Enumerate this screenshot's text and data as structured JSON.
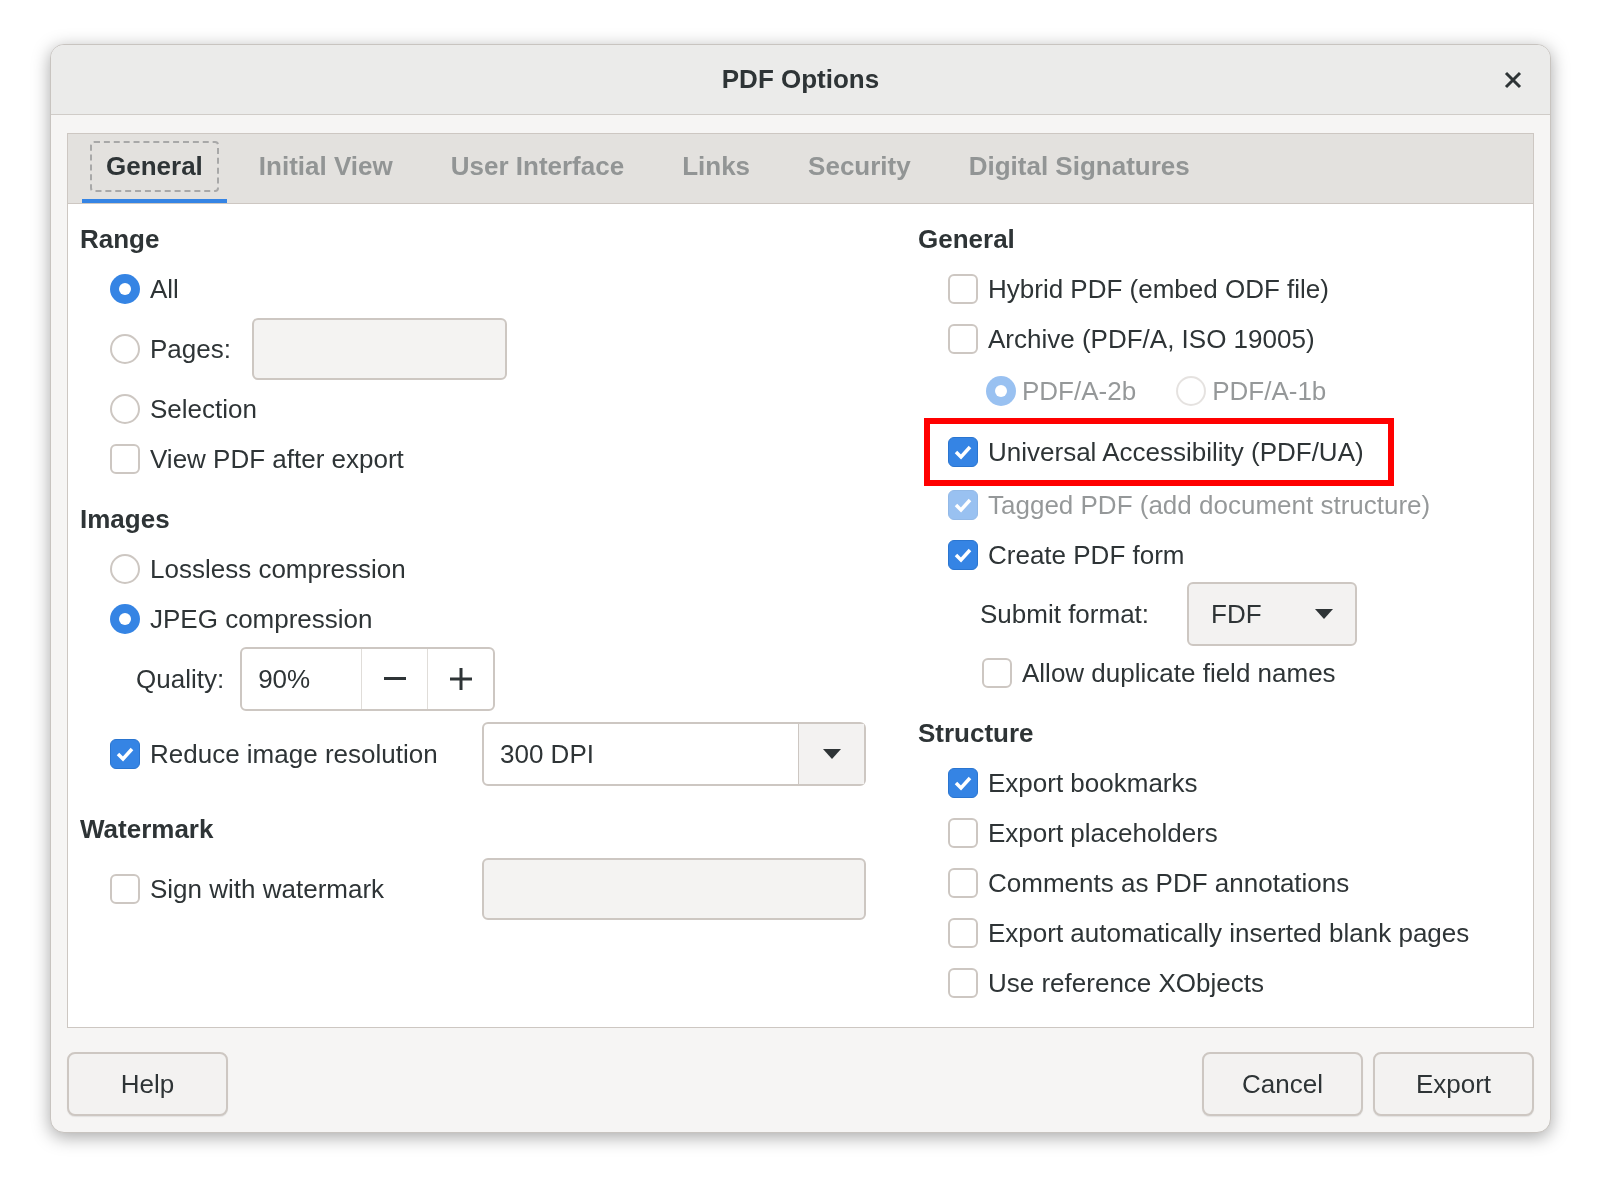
{
  "window": {
    "title": "PDF Options"
  },
  "tabs": [
    {
      "label": "General",
      "selected": true
    },
    {
      "label": "Initial View",
      "selected": false
    },
    {
      "label": "User Interface",
      "selected": false
    },
    {
      "label": "Links",
      "selected": false
    },
    {
      "label": "Security",
      "selected": false
    },
    {
      "label": "Digital Signatures",
      "selected": false
    }
  ],
  "left": [
    {
      "heading": "Range",
      "items": [
        {
          "kind": "radio",
          "label": "All",
          "selected": true
        },
        {
          "kind": "radio_field",
          "label": "Pages:",
          "selected": false,
          "field_disabled": true
        },
        {
          "kind": "radio",
          "label": "Selection",
          "selected": false
        },
        {
          "kind": "checkbox",
          "label": "View PDF after export",
          "checked": false
        }
      ]
    },
    {
      "heading": "Images",
      "items": [
        {
          "kind": "radio",
          "label": "Lossless compression",
          "selected": false
        },
        {
          "kind": "radio",
          "label": "JPEG compression",
          "selected": true
        },
        {
          "kind": "spin",
          "label": "Quality:",
          "value": "90%"
        },
        {
          "kind": "checkbox_combo",
          "label": "Reduce image resolution",
          "checked": true,
          "value": "300 DPI"
        }
      ]
    },
    {
      "heading": "Watermark",
      "items": [
        {
          "kind": "checkbox_field",
          "label": "Sign with watermark",
          "checked": false,
          "field_disabled": true
        }
      ]
    }
  ],
  "right": [
    {
      "heading": "General",
      "items": [
        {
          "kind": "checkbox",
          "label": "Hybrid PDF (embed ODF file)",
          "checked": false,
          "disabled": false
        },
        {
          "kind": "checkbox",
          "label": "Archive (PDF/A, ISO 19005)",
          "checked": false,
          "disabled": false,
          "children": [
            {
              "kind": "radio_pair",
              "disabled": true,
              "options": [
                {
                  "label": "PDF/A-2b",
                  "selected": true
                },
                {
                  "label": "PDF/A-1b",
                  "selected": false
                }
              ]
            }
          ]
        },
        {
          "kind": "checkbox",
          "label": "Universal Accessibility (PDF/UA)",
          "checked": true,
          "disabled": false,
          "highlighted": true
        },
        {
          "kind": "checkbox",
          "label": "Tagged PDF (add document structure)",
          "checked": true,
          "disabled": true
        },
        {
          "kind": "checkbox",
          "label": "Create PDF form",
          "checked": true,
          "disabled": false,
          "children": [
            {
              "kind": "combo",
              "label": "Submit format:",
              "value": "FDF"
            },
            {
              "kind": "checkbox",
              "label": "Allow duplicate field names",
              "checked": false,
              "disabled": false
            }
          ]
        }
      ]
    },
    {
      "heading": "Structure",
      "items": [
        {
          "kind": "checkbox",
          "label": "Export bookmarks",
          "checked": true,
          "disabled": false
        },
        {
          "kind": "checkbox",
          "label": "Export placeholders",
          "checked": false,
          "disabled": false
        },
        {
          "kind": "checkbox",
          "label": "Comments as PDF annotations",
          "checked": false,
          "disabled": false
        },
        {
          "kind": "checkbox",
          "label": "Export automatically inserted blank pages",
          "checked": false,
          "disabled": false
        },
        {
          "kind": "checkbox",
          "label": "Use reference XObjects",
          "checked": false,
          "disabled": false
        }
      ]
    }
  ],
  "buttons_left": [
    {
      "label": "Help"
    }
  ],
  "buttons_right": [
    {
      "label": "Cancel"
    },
    {
      "label": "Export"
    }
  ]
}
